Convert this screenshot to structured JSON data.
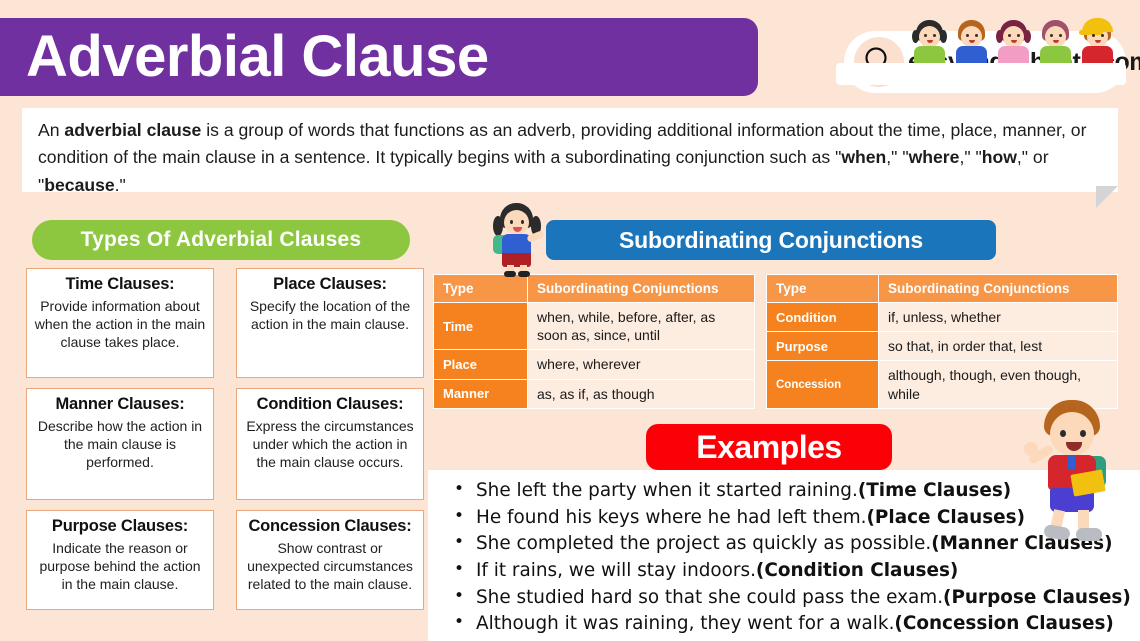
{
  "header": {
    "title": "Adverbial Clause",
    "logo_text": "easyenglishpath.com",
    "search_icon": "search-icon"
  },
  "description": {
    "parts": [
      {
        "t": "An ",
        "b": false
      },
      {
        "t": "adverbial clause",
        "b": true
      },
      {
        "t": " is a group of words that functions as an adverb, providing additional information about the time, place, manner, or condition of the main clause in a sentence. It typically begins with a subordinating conjunction such as \"",
        "b": false
      },
      {
        "t": "when",
        "b": true
      },
      {
        "t": ",\" \"",
        "b": false
      },
      {
        "t": "where",
        "b": true
      },
      {
        "t": ",\" \"",
        "b": false
      },
      {
        "t": "how",
        "b": true
      },
      {
        "t": ",\" or \"",
        "b": false
      },
      {
        "t": "because",
        "b": true
      },
      {
        "t": ".\"",
        "b": false
      }
    ]
  },
  "types_section": {
    "heading": "Types Of Adverbial Clauses",
    "items": [
      {
        "title": "Time Clauses:",
        "desc": "Provide information about when the action in the main clause takes place."
      },
      {
        "title": "Place Clauses:",
        "desc": "Specify the location of the action in the main clause."
      },
      {
        "title": "Manner Clauses:",
        "desc": "Describe how the action in the main clause is performed."
      },
      {
        "title": "Condition Clauses:",
        "desc": "Express the circumstances under which the action in the main clause occurs."
      },
      {
        "title": "Purpose Clauses:",
        "desc": "Indicate the reason or purpose behind the action in the main clause."
      },
      {
        "title": "Concession Clauses:",
        "desc": "Show contrast or unexpected circumstances related to the main clause."
      }
    ]
  },
  "conjunctions_section": {
    "heading": "Subordinating Conjunctions",
    "table_left": {
      "headers": [
        "Type",
        "Subordinating Conjunctions"
      ],
      "rows": [
        {
          "type": "Time",
          "conjunctions": "when, while, before, after, as soon as, since, until"
        },
        {
          "type": "Place",
          "conjunctions": "where, wherever"
        },
        {
          "type": "Manner",
          "conjunctions": "as, as if, as though"
        }
      ]
    },
    "table_right": {
      "headers": [
        "Type",
        "Subordinating Conjunctions"
      ],
      "rows": [
        {
          "type": "Condition",
          "conjunctions": "if, unless, whether"
        },
        {
          "type": "Purpose",
          "conjunctions": "so that, in order that, lest"
        },
        {
          "type": "Concession",
          "conjunctions": "although, though, even though, while"
        }
      ]
    }
  },
  "examples_section": {
    "heading": "Examples",
    "items": [
      {
        "sentence": "She left the party when it started raining.",
        "tag": "(Time Clauses)"
      },
      {
        "sentence": "He found his keys where he had left them.",
        "tag": "(Place Clauses)"
      },
      {
        "sentence": "She completed the project as quickly as possible.",
        "tag": "(Manner Clauses)"
      },
      {
        "sentence": "If it rains, we will stay indoors.",
        "tag": "(Condition Clauses)"
      },
      {
        "sentence": "She studied hard so that she could pass the exam.",
        "tag": "(Purpose Clauses)"
      },
      {
        "sentence": "Although it was raining, they went for a walk.",
        "tag": "(Concession Clauses)"
      }
    ]
  },
  "colors": {
    "background": "#fce5d4",
    "title_bar": "#7030a0",
    "types_pill": "#8dc63f",
    "conjunctions_pill": "#1b75bb",
    "examples_pill": "#fb0007",
    "table_header": "#f79646",
    "table_key": "#f5821f",
    "table_value_bg": "#fdece0",
    "box_border": "#e8a87c"
  }
}
